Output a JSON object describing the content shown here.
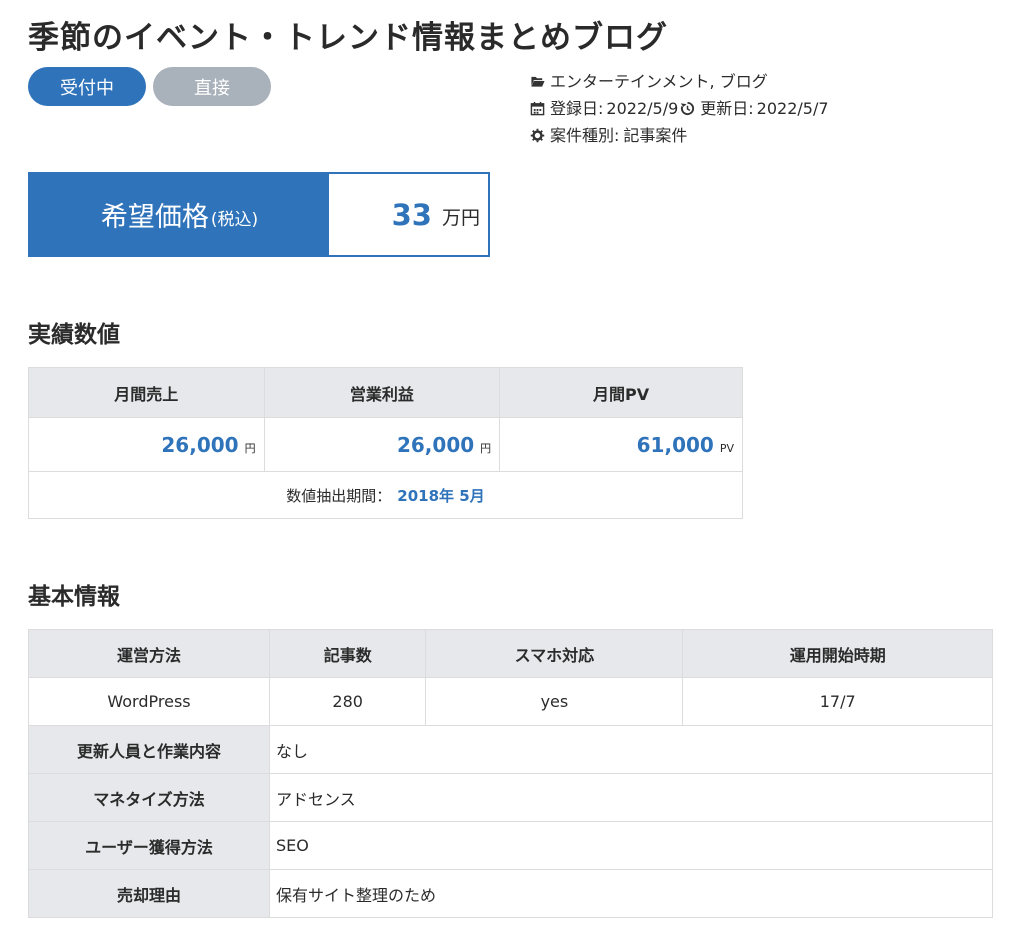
{
  "title": "季節のイベント・トレンド情報まとめブログ",
  "badges": {
    "status": "受付中",
    "type": "直接"
  },
  "meta": {
    "category": "エンターテインメント, ブログ",
    "registered_label": "登録日:",
    "registered": "2022/5/9",
    "updated_label": "更新日:",
    "updated": "2022/5/7",
    "kind_label": "案件種別:",
    "kind": "記事案件"
  },
  "price": {
    "label": "希望価格",
    "tax": "(税込)",
    "value": "33",
    "unit": "万円"
  },
  "performance": {
    "title": "実績数値",
    "headers": [
      "月間売上",
      "営業利益",
      "月間PV"
    ],
    "values": [
      {
        "value": "26,000",
        "unit": "円"
      },
      {
        "value": "26,000",
        "unit": "円"
      },
      {
        "value": "61,000",
        "unit": "PV"
      }
    ],
    "period_label": "数値抽出期間：",
    "period_value": "2018年 5月"
  },
  "basic": {
    "title": "基本情報",
    "headers": [
      "運営方法",
      "記事数",
      "スマホ対応",
      "運用開始時期"
    ],
    "values": [
      "WordPress",
      "280",
      "yes",
      "17/7"
    ],
    "rows": [
      {
        "label": "更新人員と作業内容",
        "value": "なし"
      },
      {
        "label": "マネタイズ方法",
        "value": "アドセンス"
      },
      {
        "label": "ユーザー獲得方法",
        "value": "SEO"
      },
      {
        "label": "売却理由",
        "value": "保有サイト整理のため"
      }
    ]
  },
  "colors": {
    "accent": "#2f73ba",
    "muted_badge": "#a9b1ba",
    "header_bg": "#e6e8eb"
  },
  "icons": [
    "folder-open-icon",
    "calendar-icon",
    "history-icon",
    "gear-icon"
  ]
}
